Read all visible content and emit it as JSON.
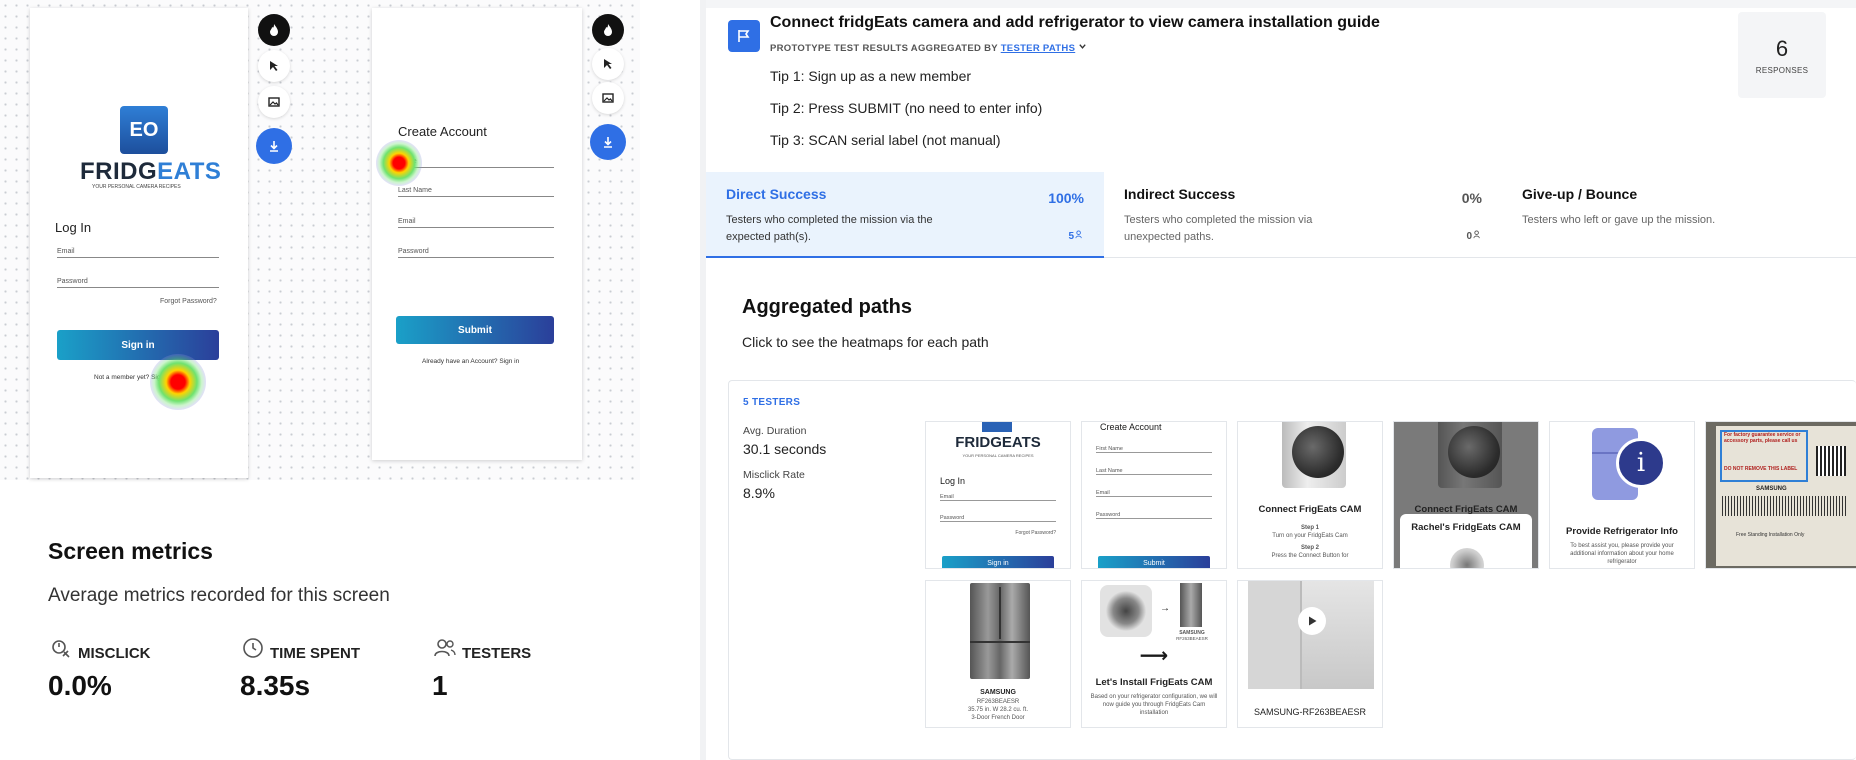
{
  "screen": {
    "phone1": {
      "logo_letters": "EO",
      "logo_name_a": "FRIDG",
      "logo_name_b": "EATS",
      "logo_tagline": "YOUR PERSONAL CAMERA RECIPES",
      "title": "Log In",
      "email_label": "Email",
      "password_label": "Password",
      "forgot": "Forgot Password?",
      "signin_button": "Sign in",
      "not_member": "Not a member yet? Sign up"
    },
    "phone2": {
      "title": "Create Account",
      "fields": [
        "Name",
        "Last Name",
        "Email",
        "Password"
      ],
      "submit_button": "Submit",
      "already": "Already have an Account? Sign in"
    }
  },
  "screen_metrics": {
    "title": "Screen metrics",
    "subtitle": "Average metrics recorded for this screen",
    "misclick_label": "MISCLICK",
    "misclick_value": "0.0%",
    "time_label": "TIME SPENT",
    "time_value": "8.35s",
    "testers_label": "TESTERS",
    "testers_value": "1"
  },
  "mission": {
    "title": "Connect fridgEats camera and add refrigerator to view camera installation guide",
    "proto_prefix": "PROTOTYPE TEST RESULTS AGGREGATED BY",
    "proto_link": "TESTER PATHS",
    "tips": [
      "Tip 1: Sign up as a new member",
      "Tip 2: Press SUBMIT (no need to enter info)",
      "Tip 3: SCAN serial label (not manual)"
    ],
    "responses_count": "6",
    "responses_label": "RESPONSES"
  },
  "success": [
    {
      "title": "Direct Success",
      "percent": "100%",
      "desc": "Testers who completed the mission via the expected path(s).",
      "count": "5"
    },
    {
      "title": "Indirect Success",
      "percent": "0%",
      "desc": "Testers who completed the mission via unexpected paths.",
      "count": "0"
    },
    {
      "title": "Give-up / Bounce",
      "percent": "",
      "desc": "Testers who left or gave up the mission.",
      "count": ""
    }
  ],
  "aggregated": {
    "title": "Aggregated paths",
    "subtitle": "Click to see the heatmaps for each path",
    "testers": "5 TESTERS",
    "avg_duration_label": "Avg. Duration",
    "avg_duration_value": "30.1 seconds",
    "misclick_label": "Misclick Rate",
    "misclick_value": "8.9%"
  },
  "thumbs": {
    "t1": {
      "logo": "FRIDGEATS",
      "tagline": "YOUR PERSONAL CAMERA RECIPES",
      "title": "Log In",
      "email": "Email",
      "password": "Password",
      "forgot": "Forgot Password?",
      "button": "Sign in"
    },
    "t2": {
      "title": "Create Account",
      "f1": "First Name",
      "f2": "Last Name",
      "f3": "Email",
      "f4": "Password",
      "button": "Submit"
    },
    "t3": {
      "title": "Connect FrigEats CAM",
      "step1": "Step 1",
      "step1_text": "Turn on your FridgEats Cam",
      "step2": "Step 2",
      "step2_text": "Press the Connect Button for"
    },
    "t4": {
      "title": "Connect FrigEats CAM",
      "popup": "Rachel's FridgEats CAM"
    },
    "t5": {
      "title": "Provide Refrigerator Info",
      "text": "To best assist you, please provide your additional information about your home refrigerator"
    },
    "t6": {
      "line1": "For factory guarantee service or accessory parts, please call us",
      "line2": "DO NOT REMOVE THIS LABEL",
      "brand": "SAMSUNG",
      "note": "Free Standing Installation Only"
    },
    "t7": {
      "brand": "SAMSUNG",
      "model": "RF263BEAESR",
      "size": "35.75 in. W 28.2 cu. ft.",
      "type": "3-Door French Door"
    },
    "t8": {
      "brand": "SAMSUNG",
      "model": "RF263BEAESR",
      "title": "Let's Install FrigEats CAM",
      "text": "Based on your refrigerator configuration, we will now guide you through FridgEats Cam installation"
    },
    "t9": {
      "label": "SAMSUNG-RF263BEAESR"
    }
  }
}
